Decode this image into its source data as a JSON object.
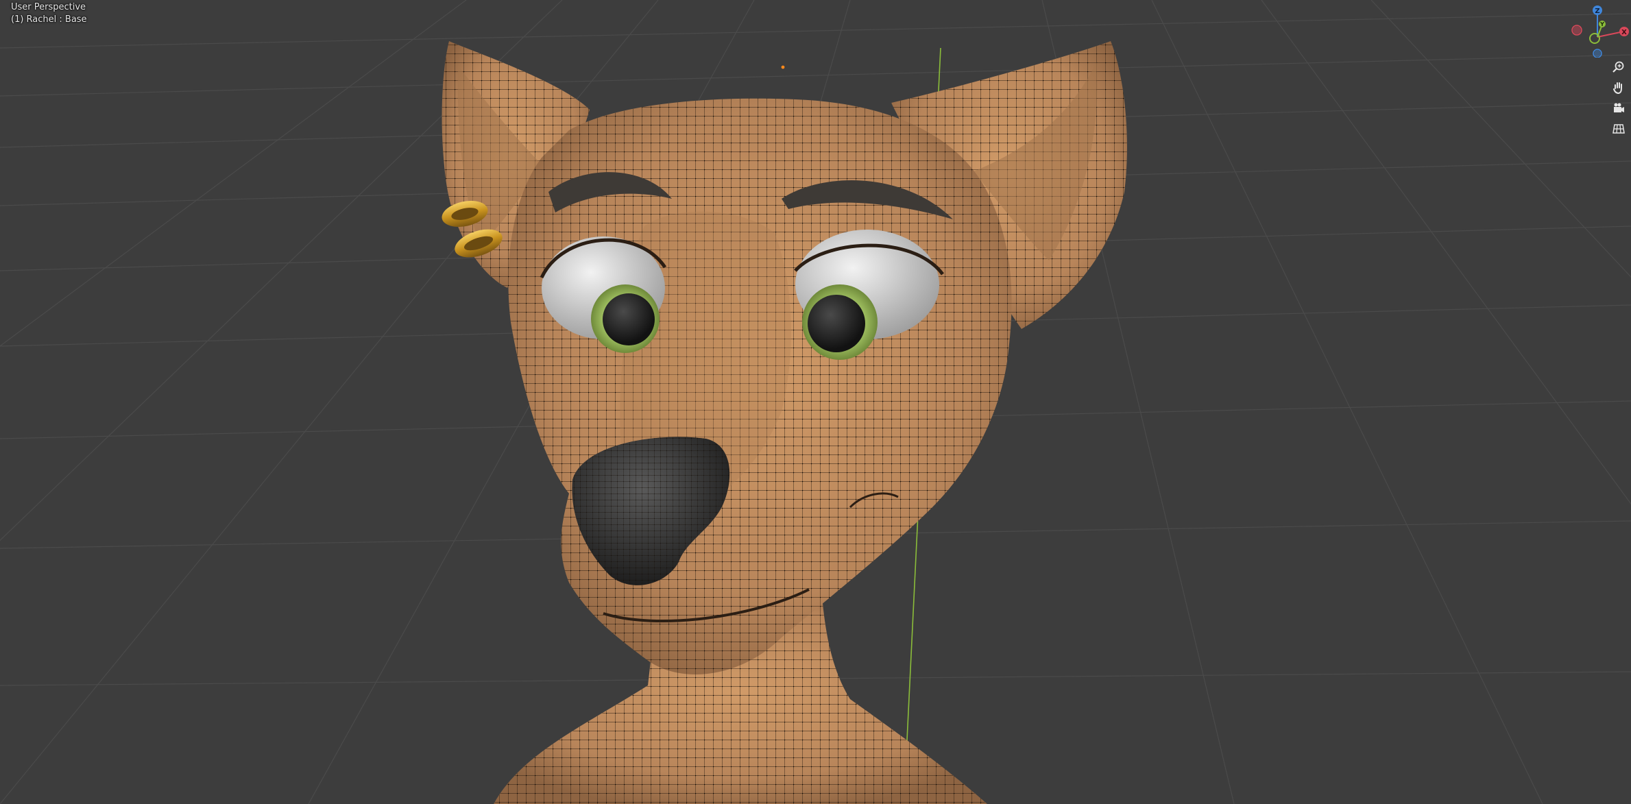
{
  "viewport": {
    "view_name": "User Perspective",
    "object_info": "(1) Rachel : Base",
    "colors": {
      "background": "#3d3d3d",
      "grid": "#4c4c4c",
      "y_axis": "#8bbd3a",
      "skin": "#c08c5c",
      "nose": "#3a3a3a",
      "iris": "#95b45a",
      "earring": "#d9a730"
    }
  },
  "gizmo": {
    "z_label": "Z",
    "y_label": "Y",
    "x_label": "X",
    "colors": {
      "x": "#d9485a",
      "y": "#8bbd3a",
      "z": "#3f86db"
    }
  },
  "nav_tools": [
    {
      "name": "zoom-icon"
    },
    {
      "name": "hand-pan-icon"
    },
    {
      "name": "camera-view-icon"
    },
    {
      "name": "ortho-grid-icon"
    }
  ]
}
